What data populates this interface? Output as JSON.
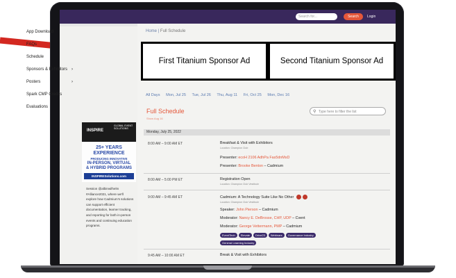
{
  "header": {
    "search_placeholder": "Search for...",
    "search_button": "Search",
    "login": "Login"
  },
  "sidebar": {
    "items": [
      {
        "label": "App Download"
      },
      {
        "label": "FAQs"
      },
      {
        "label": "Schedule"
      },
      {
        "label": "Sponsors & Exhibitors",
        "chevron": "›"
      },
      {
        "label": "Posters",
        "chevron": "›"
      },
      {
        "label": "Spark CMP Credits"
      },
      {
        "label": "Evaluations"
      }
    ],
    "ad": {
      "brand": "INSPIRE",
      "tagline": "GLOBAL EVENT SOLUTIONS",
      "years": "25+ YEARS",
      "experience": "EXPERIENCE",
      "line1": "PRODUCING INNOVATIVE",
      "line2": "IN-PERSON, VIRTUAL",
      "line3": "& HYBRID PROGRAMS",
      "url": "INSPIRESolutions.com"
    },
    "tweet": "Session @albinwilhelm #Alliance2021, where we'll explore how Cadmium's solutions can support efficient documentation, learner tracking, and reporting for both in-person events and continuing education programs."
  },
  "breadcrumb": {
    "home": "Home",
    "current": "Full Schedule"
  },
  "sponsors": {
    "first": "First Titanium Sponsor Ad",
    "second": "Second Titanium Sponsor Ad"
  },
  "day_tabs": [
    "All Days",
    "Mon, Jul 25",
    "Tue, Jul 26",
    "Thu, Aug 11",
    "Fri, Oct 25",
    "Mon, Dec 16"
  ],
  "schedule": {
    "title": "Full Schedule",
    "subtitle": "Show Aug 16",
    "filter_placeholder": "Type here to filter the list",
    "date": "Monday, July 25, 2022",
    "events": [
      {
        "time": "8:00 AM – 9:00 AM ET",
        "title": "Breakfast & Visit with Exhibitors",
        "location": "Location: Champion Club",
        "presenter1_label": "Presenter:",
        "presenter1": "ecoH 2106 AdhPa Fas5dnMsD",
        "presenter2_label": "Presenter:",
        "presenter2": "Brooke Benton",
        "presenter2_org": "– Cadmium"
      },
      {
        "time": "8:00 AM – 5:00 PM ET",
        "title": "Registration Open",
        "location": "Location: Champion Club Vestibule"
      },
      {
        "time": "9:00 AM – 9:45 AM ET",
        "title": "Cadmium: A Technology Suite Like No Other",
        "location": "Location: Champion Club Vestibule",
        "speaker_label": "Speaker:",
        "speaker": "John Pierson",
        "speaker_org": "– Cadmium",
        "moderator1_label": "Moderator:",
        "moderator1": "Nancy E. DeBrosse, CHP, UDP",
        "moderator1_org": "– Cvent",
        "moderator2_label": "Moderator:",
        "moderator2": "George Vettermann, PMP",
        "moderator2_org": "– Cadmium",
        "tags": [
          "EventTech",
          "Elevate",
          "Drive23",
          "Webinars",
          "Governance Industry"
        ],
        "tag_row2": "General Learning Industry"
      },
      {
        "time": "9:45 AM – 10:00 AM ET",
        "title": "Break & Visit with Exhibitors"
      }
    ]
  }
}
